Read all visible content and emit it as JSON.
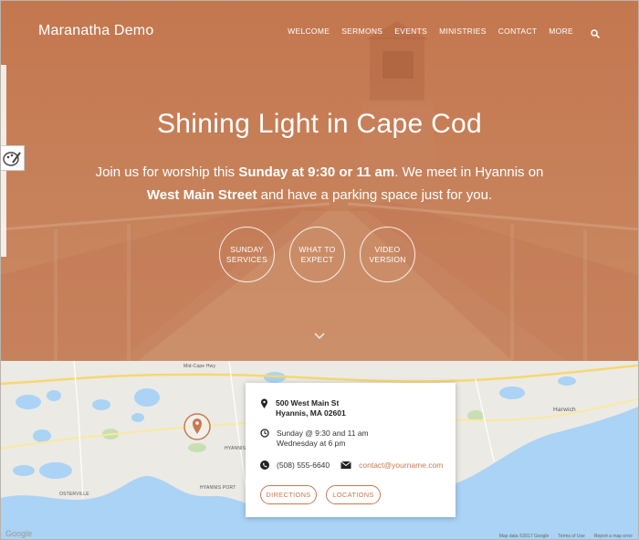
{
  "site": {
    "logo": "Maranatha Demo"
  },
  "nav": {
    "items": [
      "WELCOME",
      "SERMONS",
      "EVENTS",
      "MINISTRIES",
      "CONTACT",
      "MORE"
    ],
    "search_icon": "search-icon"
  },
  "hero": {
    "title": "Shining Light in Cape Cod",
    "text_1": "Join us for worship this ",
    "text_bold_1": "Sunday at 9:30 or 11 am",
    "text_2": ". We meet in Hyannis on ",
    "text_bold_2": "West Main Street",
    "text_3": " and have a parking space just for you.",
    "buttons": [
      {
        "line1": "SUNDAY",
        "line2": "SERVICES"
      },
      {
        "line1": "WHAT TO",
        "line2": "EXPECT"
      },
      {
        "line1": "VIDEO",
        "line2": "VERSION"
      }
    ],
    "accent_color": "#c67a53"
  },
  "map": {
    "labels": {
      "hyannis": "HYANNIS",
      "hyannis_port": "HYANNIS PORT",
      "osterville": "OSTERVILLE",
      "harwich": "Harwich",
      "mid_cape": "Mid-Cape Hwy"
    },
    "footer": [
      "Map data ©2017 Google",
      "Terms of Use",
      "Report a map error"
    ],
    "google": "Google"
  },
  "info": {
    "address_line1": "500 West Main St",
    "address_line2": "Hyannis, MA 02601",
    "time_line1": "Sunday @ 9:30 and 11 am",
    "time_line2": "Wednesday at 6 pm",
    "phone": "(508) 555-6640",
    "email": "contact@yourname.com",
    "btn_directions": "DIRECTIONS",
    "btn_locations": "LOCATIONS"
  }
}
